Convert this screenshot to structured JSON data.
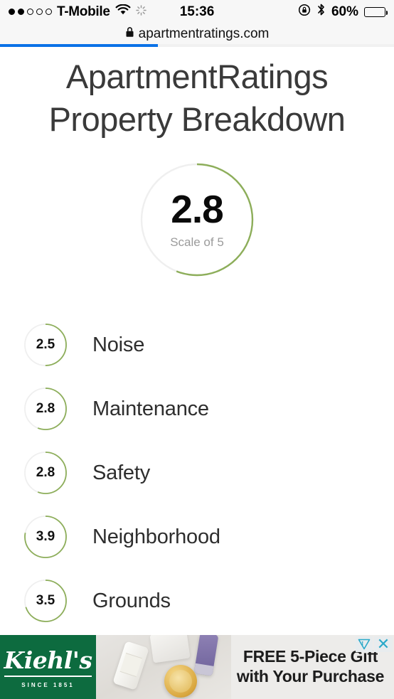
{
  "status_bar": {
    "signal_total": 5,
    "signal_filled": 2,
    "carrier": "T-Mobile",
    "wifi_icon": "wifi-icon",
    "activity_icon": "activity-spinner-icon",
    "time": "15:36",
    "rotation_lock_icon": "rotation-lock-icon",
    "bluetooth_icon": "bluetooth-icon",
    "battery_percent": "60%",
    "battery_level": 60
  },
  "browser": {
    "lock_icon": "lock-icon",
    "url": "apartmentratings.com",
    "loading_progress": 40,
    "progress_color": "#0b72e7"
  },
  "page": {
    "title_line1": "ApartmentRatings",
    "title_line2": "Property Breakdown",
    "accent_color": "#8dae5a",
    "track_color": "#efefef"
  },
  "overall": {
    "score": "2.8",
    "value": 2.8,
    "max": 5,
    "scale_label": "Scale of 5"
  },
  "ratings": [
    {
      "score": "2.5",
      "value": 2.5,
      "label": "Noise"
    },
    {
      "score": "2.8",
      "value": 2.8,
      "label": "Maintenance"
    },
    {
      "score": "2.8",
      "value": 2.8,
      "label": "Safety"
    },
    {
      "score": "3.9",
      "value": 3.9,
      "label": "Neighborhood"
    },
    {
      "score": "3.5",
      "value": 3.5,
      "label": "Grounds"
    }
  ],
  "ad": {
    "brand": "Kiehl's",
    "since": "SINCE 1851",
    "headline_line1": "FREE 5-Piece Gift",
    "headline_line2": "with Your Purchase",
    "adchoices_icon": "adchoices-icon",
    "close_icon": "close-icon",
    "brand_color": "#0d6b3f"
  }
}
